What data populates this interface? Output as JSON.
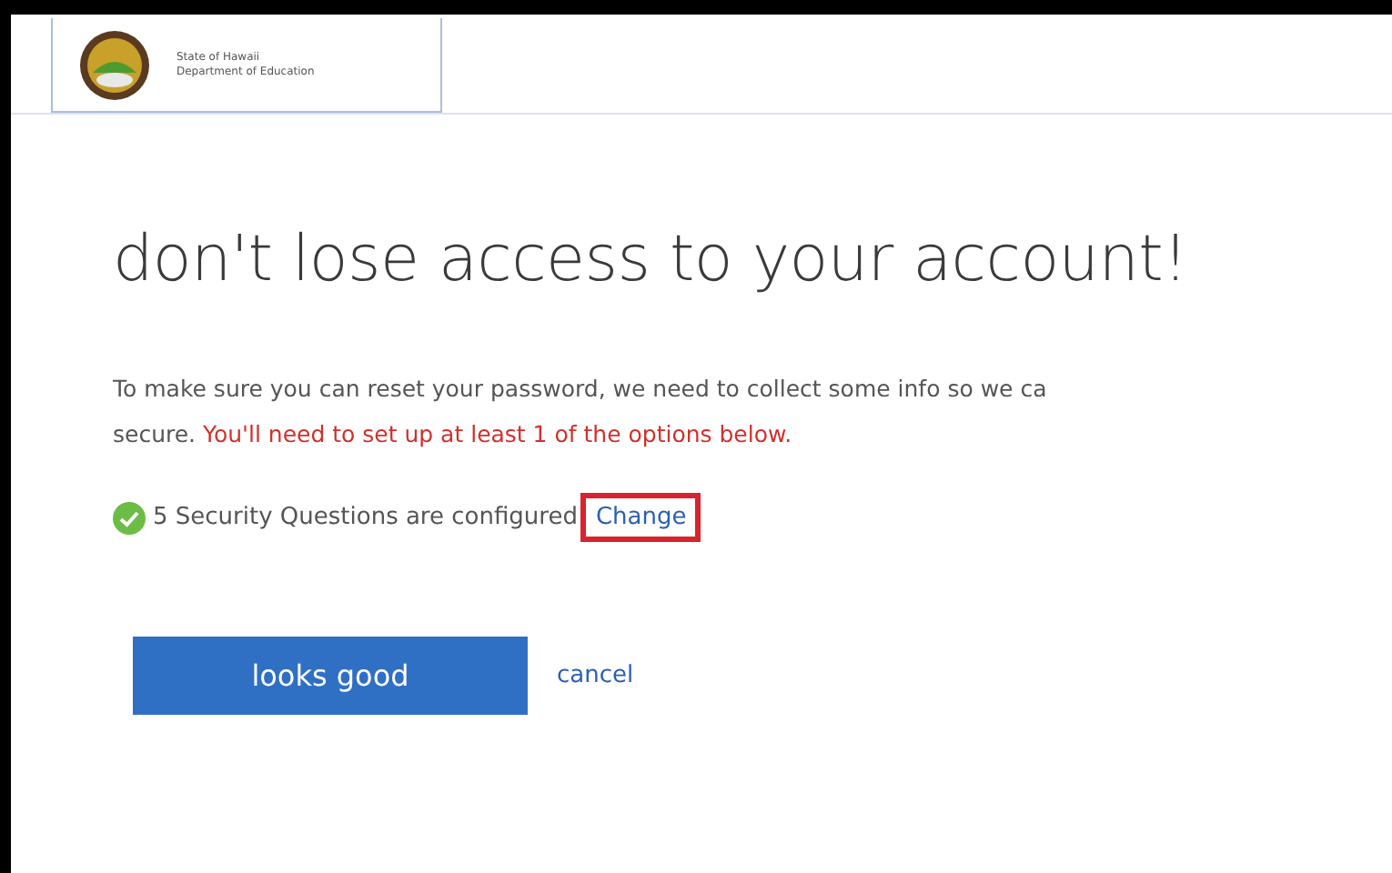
{
  "header": {
    "org_line1": "State of Hawaii",
    "org_line2": "Department of Education"
  },
  "title": "don't lose access to your account!",
  "intro": {
    "line1": "To make sure you can reset your password, we need to collect some info so we ca",
    "line2": "secure.",
    "warning": "You'll need to set up at least 1 of the options below."
  },
  "methods": [
    {
      "label": "5 Security Questions are configured",
      "configured": true,
      "action": "Change",
      "highlighted": true
    }
  ],
  "buttons": {
    "primary": "looks good",
    "secondary": "cancel"
  }
}
